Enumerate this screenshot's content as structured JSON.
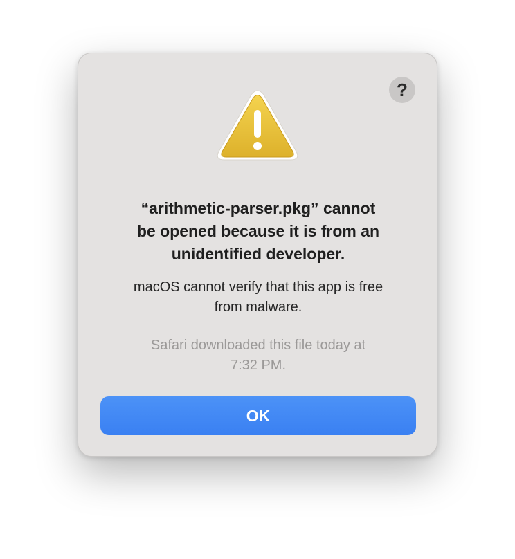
{
  "dialog": {
    "help_label": "?",
    "icon": "warning-triangle-icon",
    "title": "“arithmetic-parser.pkg” cannot\nbe opened because it is from an\nunidentified developer.",
    "message": "macOS cannot verify that this app is free\nfrom malware.",
    "info": "Safari downloaded this file today at\n7:32 PM.",
    "ok_label": "OK"
  },
  "colors": {
    "dialog_background": "#e4e2e1",
    "accent": "#3a80f2",
    "warning": "#e9be2e"
  }
}
